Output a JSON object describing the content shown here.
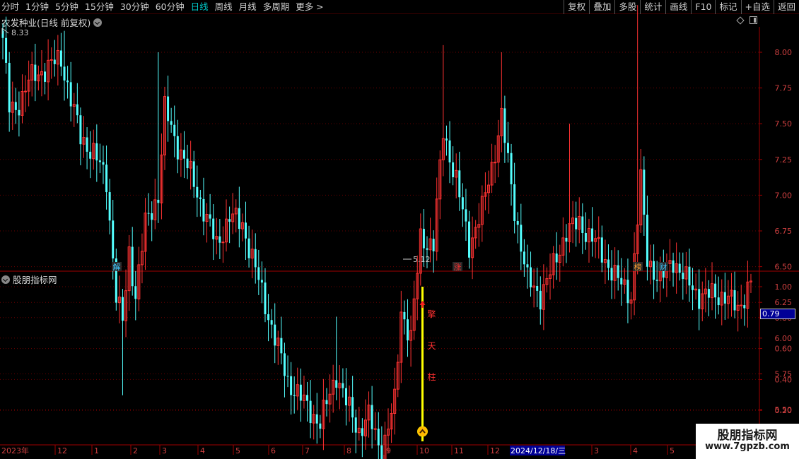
{
  "toolbar": {
    "periods": [
      {
        "label": "分时",
        "active": false
      },
      {
        "label": "1分钟",
        "active": false
      },
      {
        "label": "5分钟",
        "active": false
      },
      {
        "label": "15分钟",
        "active": false
      },
      {
        "label": "30分钟",
        "active": false
      },
      {
        "label": "60分钟",
        "active": false
      },
      {
        "label": "日线",
        "active": true
      },
      {
        "label": "周线",
        "active": false
      },
      {
        "label": "月线",
        "active": false
      },
      {
        "label": "多周期",
        "active": false
      },
      {
        "label": "更多 >",
        "active": false
      }
    ],
    "tools": [
      "复权",
      "叠加",
      "多股",
      "统计",
      "画线",
      "F10",
      "标记",
      "+自选",
      "返回"
    ]
  },
  "main_chart": {
    "title": "农发种业(日线 前复权)",
    "high_label": "8.33",
    "low_label": "5.12",
    "markers": [
      {
        "text": "解",
        "color": "#3fc8ff"
      },
      {
        "text": "涨",
        "color": "#ff3030"
      },
      {
        "text": "榜",
        "color": "#ffa030"
      },
      {
        "text": "财",
        "color": "#3fc8ff"
      }
    ]
  },
  "indicator": {
    "title": "股朋指标网",
    "current_value": "0.79",
    "signal_text": [
      "擎",
      "天",
      "柱"
    ]
  },
  "date_axis": {
    "labels": [
      "2023年",
      "12",
      "1",
      "2",
      "3",
      "4",
      "5",
      "6",
      "7",
      "8",
      "9",
      "10",
      "11",
      "12",
      "2024/12/18/三",
      "3",
      "4",
      "5"
    ],
    "highlight": "2024/12/18/三"
  },
  "watermark": {
    "title": "股朋指标网",
    "url": "www.7gpzb.com"
  },
  "chart_data": {
    "type": "candlestick",
    "price_axis": {
      "ticks": [
        5.5,
        5.75,
        6.0,
        6.25,
        6.5,
        6.75,
        7.0,
        7.25,
        7.5,
        7.75,
        8.0
      ],
      "range": [
        5.0,
        8.5
      ]
    },
    "indicator_axis": {
      "ticks": [
        0.2,
        0.4,
        0.6,
        0.8,
        1.0
      ],
      "range": [
        0.0,
        1.1
      ]
    },
    "anchors": [
      {
        "i": 0,
        "p": 8.1
      },
      {
        "i": 2,
        "p": 7.6
      },
      {
        "i": 4,
        "p": 7.6
      },
      {
        "i": 8,
        "p": 7.8
      },
      {
        "i": 14,
        "p": 7.9
      },
      {
        "i": 18,
        "p": 7.95
      },
      {
        "i": 24,
        "p": 7.4
      },
      {
        "i": 28,
        "p": 7.3
      },
      {
        "i": 32,
        "p": 7.1
      },
      {
        "i": 35,
        "p": 6.3
      },
      {
        "i": 37,
        "p": 6.1
      },
      {
        "i": 39,
        "p": 6.6
      },
      {
        "i": 41,
        "p": 6.3
      },
      {
        "i": 44,
        "p": 6.8
      },
      {
        "i": 48,
        "p": 7.0
      },
      {
        "i": 50,
        "p": 7.6
      },
      {
        "i": 53,
        "p": 7.4
      },
      {
        "i": 57,
        "p": 7.2
      },
      {
        "i": 62,
        "p": 6.9
      },
      {
        "i": 66,
        "p": 6.65
      },
      {
        "i": 70,
        "p": 6.85
      },
      {
        "i": 74,
        "p": 6.8
      },
      {
        "i": 79,
        "p": 6.4
      },
      {
        "i": 84,
        "p": 6.0
      },
      {
        "i": 88,
        "p": 5.7
      },
      {
        "i": 93,
        "p": 5.55
      },
      {
        "i": 98,
        "p": 5.4
      },
      {
        "i": 103,
        "p": 5.75
      },
      {
        "i": 106,
        "p": 5.55
      },
      {
        "i": 110,
        "p": 5.35
      },
      {
        "i": 113,
        "p": 5.45
      },
      {
        "i": 117,
        "p": 5.2
      },
      {
        "i": 121,
        "p": 5.55
      },
      {
        "i": 123,
        "p": 6.2
      },
      {
        "i": 126,
        "p": 6.0
      },
      {
        "i": 129,
        "p": 6.7
      },
      {
        "i": 133,
        "p": 6.65
      },
      {
        "i": 136,
        "p": 7.45
      },
      {
        "i": 140,
        "p": 7.1
      },
      {
        "i": 144,
        "p": 6.65
      },
      {
        "i": 148,
        "p": 6.9
      },
      {
        "i": 151,
        "p": 7.2
      },
      {
        "i": 154,
        "p": 7.55
      },
      {
        "i": 158,
        "p": 6.9
      },
      {
        "i": 162,
        "p": 6.4
      },
      {
        "i": 166,
        "p": 6.3
      },
      {
        "i": 170,
        "p": 6.5
      },
      {
        "i": 174,
        "p": 6.75
      },
      {
        "i": 178,
        "p": 6.8
      },
      {
        "i": 182,
        "p": 6.7
      },
      {
        "i": 186,
        "p": 6.55
      },
      {
        "i": 190,
        "p": 6.4
      },
      {
        "i": 194,
        "p": 6.3
      },
      {
        "i": 197,
        "p": 7.1
      },
      {
        "i": 199,
        "p": 6.55
      },
      {
        "i": 203,
        "p": 6.4
      },
      {
        "i": 207,
        "p": 6.55
      },
      {
        "i": 211,
        "p": 6.4
      },
      {
        "i": 215,
        "p": 6.3
      },
      {
        "i": 219,
        "p": 6.3
      },
      {
        "i": 223,
        "p": 6.3
      },
      {
        "i": 227,
        "p": 6.2
      },
      {
        "i": 231,
        "p": 6.4
      }
    ],
    "spikes": [
      {
        "i": 19,
        "high": 8.15
      },
      {
        "i": 37,
        "low": 5.6
      },
      {
        "i": 48,
        "high": 8.0
      },
      {
        "i": 103,
        "high": 6.15
      },
      {
        "i": 117,
        "low": 5.12
      },
      {
        "i": 126,
        "low": 5.8
      },
      {
        "i": 136,
        "high": 8.05
      },
      {
        "i": 154,
        "high": 8.0
      },
      {
        "i": 175,
        "high": 7.5
      },
      {
        "i": 196,
        "high": 8.33
      }
    ],
    "signal": {
      "bar_index": 125,
      "from": 0.0,
      "to": 1.0,
      "value": 0.79
    }
  }
}
